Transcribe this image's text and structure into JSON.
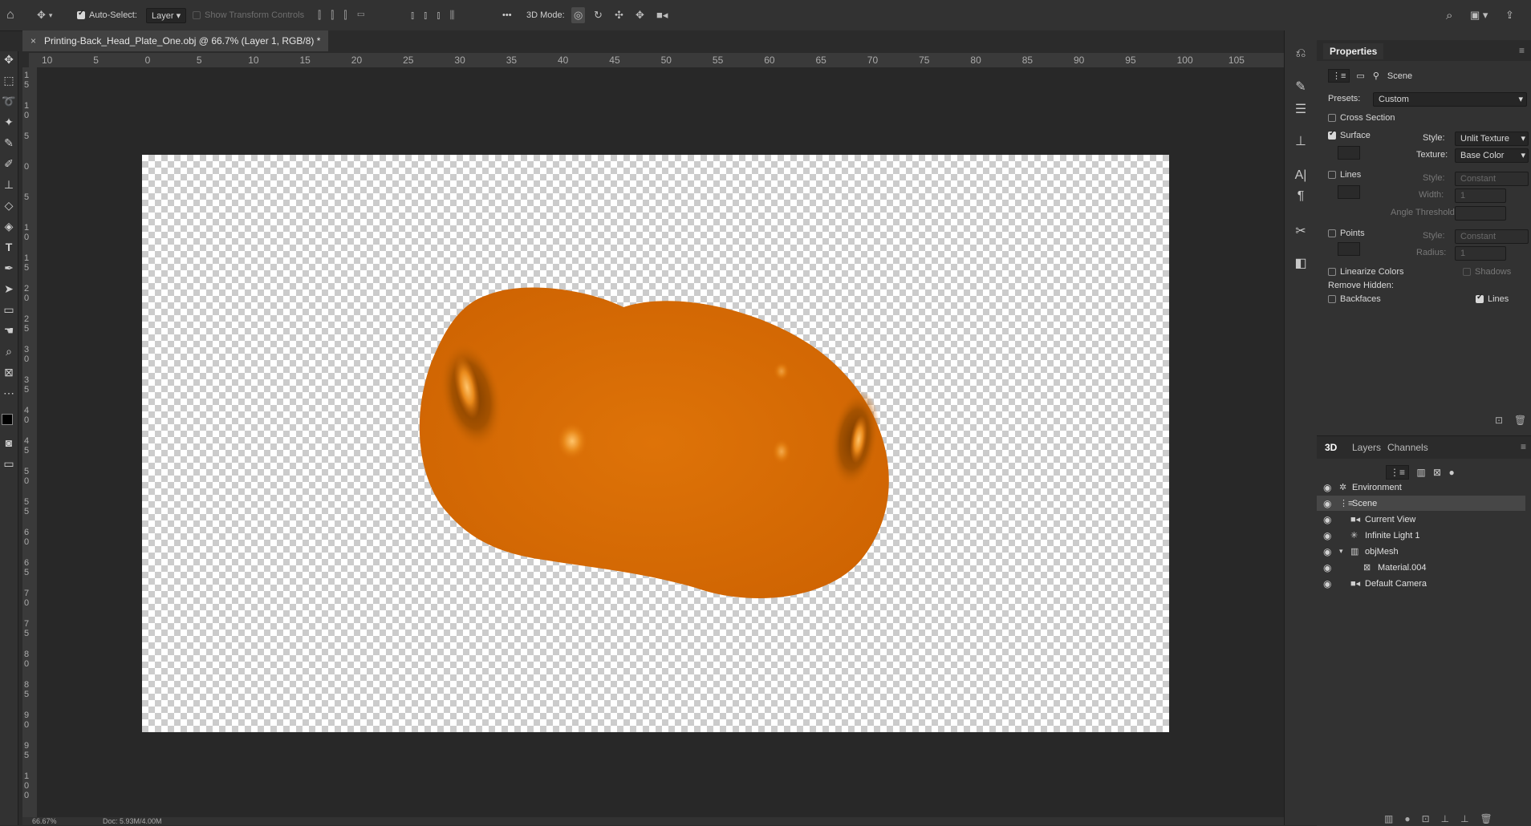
{
  "options_bar": {
    "auto_select_label": "Auto-Select:",
    "auto_select_value": "Layer",
    "show_transform_label": "Show Transform Controls",
    "mode_label": "3D Mode:",
    "more": "•••"
  },
  "document_tab": {
    "close": "×",
    "title": "Printing-Back_Head_Plate_One.obj @ 66.7% (Layer 1, RGB/8) *"
  },
  "ruler": {
    "h_labels": [
      "10",
      "5",
      "0",
      "5",
      "10",
      "15",
      "20",
      "25",
      "30",
      "35",
      "40",
      "45",
      "50",
      "55",
      "60",
      "65",
      "70",
      "75",
      "80",
      "85",
      "90",
      "95",
      "100",
      "105"
    ],
    "v_labels": [
      "1\n5",
      "1\n0",
      "5",
      "0",
      "5",
      "1\n0",
      "1\n5",
      "2\n0",
      "2\n5",
      "3\n0",
      "3\n5",
      "4\n0",
      "4\n5",
      "5\n0",
      "5\n5",
      "6\n0",
      "6\n5",
      "7\n0",
      "7\n5",
      "8\n0",
      "8\n5",
      "9\n0",
      "9\n5",
      "1\n0\n0"
    ]
  },
  "status_bar": {
    "zoom": "66.67%",
    "doc": "Doc: 5.93M/4.00M"
  },
  "properties": {
    "panel_title": "Properties",
    "scene_label": "Scene",
    "presets_label": "Presets:",
    "presets_value": "Custom",
    "cross_section": "Cross Section",
    "surface": "Surface",
    "surface_style_label": "Style:",
    "surface_style_value": "Unlit Texture",
    "texture_label": "Texture:",
    "texture_value": "Base Color",
    "lines": "Lines",
    "lines_style_label": "Style:",
    "lines_style_value": "Constant",
    "width_label": "Width:",
    "width_value": "1",
    "angle_label": "Angle Threshold:",
    "points": "Points",
    "points_style_label": "Style:",
    "points_style_value": "Constant",
    "radius_label": "Radius:",
    "radius_value": "1",
    "linearize": "Linearize Colors",
    "shadows": "Shadows",
    "remove_hidden": "Remove Hidden:",
    "backfaces": "Backfaces",
    "lines_check": "Lines"
  },
  "panel_3d": {
    "tabs": [
      "3D",
      "Layers",
      "Channels"
    ],
    "rows": [
      {
        "label": "Environment",
        "icon": "environment-icon"
      },
      {
        "label": "Scene",
        "icon": "scene-icon"
      },
      {
        "label": "Current View",
        "icon": "camera-icon"
      },
      {
        "label": "Infinite Light 1",
        "icon": "light-icon"
      },
      {
        "label": "objMesh",
        "icon": "mesh-icon"
      },
      {
        "label": "Material.004",
        "icon": "material-icon"
      },
      {
        "label": "Default Camera",
        "icon": "camera-icon"
      }
    ]
  },
  "colors": {
    "object_orange": "#d96c04",
    "panel_bg": "#323232",
    "canvas_bg": "#282828"
  }
}
